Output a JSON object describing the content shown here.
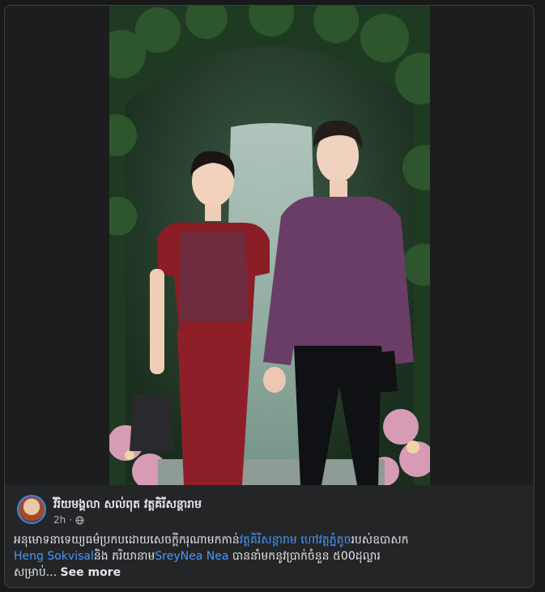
{
  "post": {
    "author_name": "វិរិយមង្គលា សល់ពុត វត្តគិរីសន្តារាម",
    "timestamp": "2h",
    "separator": "·",
    "privacy_icon": "globe-icon",
    "caption": {
      "part1": "អនុមោទនាទេយ្យធម៌ប្រកបដោយសេចក្តីករុណាមកកាន់",
      "link1": "វត្តគិរីសន្តារាម",
      "link2": "ហៅវត្តភ្នំតូច",
      "part2": "របស់ឧបាសក",
      "link3": "Heng Sokvisal",
      "part3": "និង ភរិយានាម",
      "link4": "SreyNea Nea",
      "part4": " បាននាំមកនូវប្រាក់ចំនួន ៥00ដុល្លារ",
      "part5": "សម្រាប់...",
      "see_more": "See more"
    }
  },
  "colors": {
    "background": "#18191a",
    "card": "#242526",
    "text": "#e4e6eb",
    "secondary_text": "#b0b3b8",
    "link": "#4599ff"
  }
}
